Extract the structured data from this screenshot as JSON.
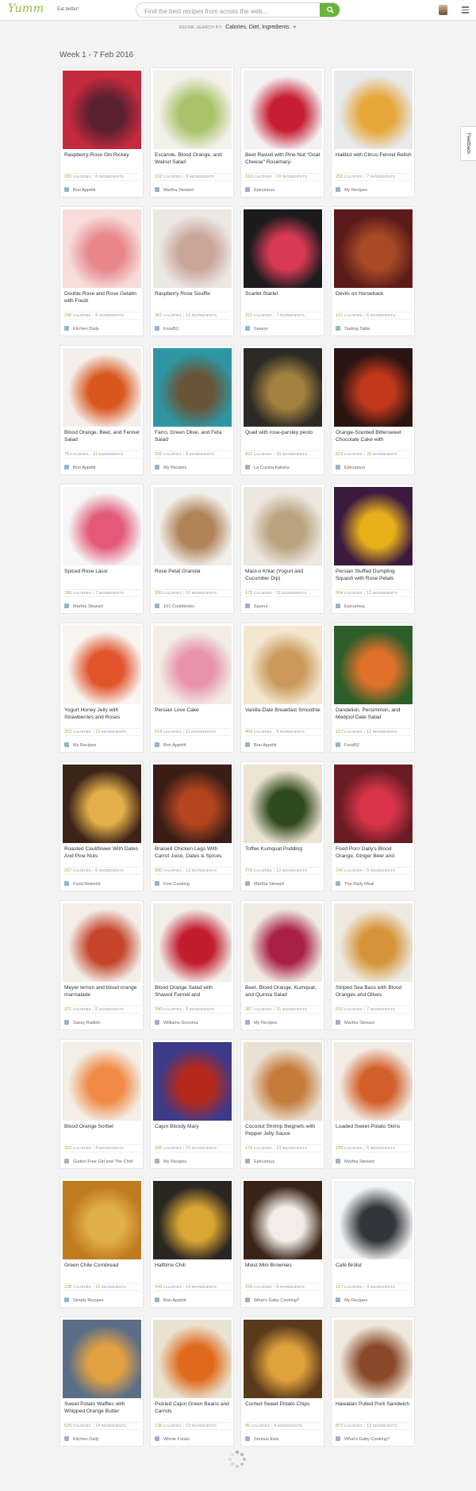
{
  "app": {
    "logo_text": "Yumm",
    "tagline": "Eat better!"
  },
  "search": {
    "placeholder": "Find the best recipes from across the web..."
  },
  "refine": {
    "label": "REFINE SEARCH BY:",
    "value": "Calories, Diet, Ingredients"
  },
  "feedback_label": "Feedback",
  "week_label": "Week 1 - 7 Feb 2016",
  "stat_labels": {
    "calories": "CALORIES",
    "ingredients": "INGREDIENTS"
  },
  "recipes": [
    {
      "title": "Raspberry-Rose Gin Rickey",
      "calories": "289",
      "ingredients": "6",
      "source": "Bon Appétit",
      "colors": [
        "#c62a3f",
        "#5b2030"
      ]
    },
    {
      "title": "Escarole, Blood Orange, and Walnut Salad",
      "calories": "152",
      "ingredients": "9",
      "source": "Martha Stewart",
      "colors": [
        "#f4f1ea",
        "#a9c36a"
      ]
    },
    {
      "title": "Beet Ravioli with Pine Nut \"Goat Cheese\" Rosemary-",
      "calories": "319",
      "ingredients": "19",
      "source": "Epicurious",
      "colors": [
        "#f3f1f1",
        "#c71e34"
      ]
    },
    {
      "title": "Halibut with Citrus-Fennel Relish",
      "calories": "253",
      "ingredients": "7",
      "source": "My Recipes",
      "colors": [
        "#e7e9ea",
        "#e7a63a"
      ]
    },
    {
      "title": "Double Rose and Rose Gelatin with Fresh",
      "calories": "246",
      "ingredients": "9",
      "source": "Kitchen Daily",
      "colors": [
        "#f7dcd9",
        "#e8868c"
      ]
    },
    {
      "title": "Raspberry Rose Souffle",
      "calories": "381",
      "ingredients": "12",
      "source": "Food52",
      "colors": [
        "#ebe7e3",
        "#c9a59a"
      ]
    },
    {
      "title": "Scarlet Starlet",
      "calories": "221",
      "ingredients": "7",
      "source": "Saveur",
      "colors": [
        "#1c1b1e",
        "#d83a55"
      ]
    },
    {
      "title": "Devils on Horseback",
      "calories": "101",
      "ingredients": "6",
      "source": "Tasting Table",
      "colors": [
        "#5b1b1a",
        "#a84a25"
      ]
    },
    {
      "title": "Blood Orange, Beet, and Fennel Salad",
      "calories": "75",
      "ingredients": "11",
      "source": "Bon Appétit",
      "colors": [
        "#f4efea",
        "#d9571f"
      ]
    },
    {
      "title": "Farro, Green Olive, and Feta Salad",
      "calories": "292",
      "ingredients": "8",
      "source": "My Recipes",
      "colors": [
        "#2e96a2",
        "#6a5438"
      ]
    },
    {
      "title": "Quail with rose-parsley pesto",
      "calories": "822",
      "ingredients": "15",
      "source": "La Cucina Italiana",
      "colors": [
        "#2d2a25",
        "#a2823e"
      ]
    },
    {
      "title": "Orange-Scented Bittersweet Chocolate Cake with",
      "calories": "823",
      "ingredients": "20",
      "source": "Epicurious",
      "colors": [
        "#2a1513",
        "#c1381b"
      ]
    },
    {
      "title": "Spiced Rose Lassi",
      "calories": "186",
      "ingredients": "7",
      "source": "Martha Stewart",
      "colors": [
        "#f6f6f6",
        "#e35a79"
      ]
    },
    {
      "title": "Rose Petal Granola",
      "calories": "300",
      "ingredients": "10",
      "source": "101 Cookbooks",
      "colors": [
        "#f2f0ec",
        "#b08358"
      ]
    },
    {
      "title": "Mast-o Khiar (Yogurt and Cucumber Dip)",
      "calories": "176",
      "ingredients": "11",
      "source": "Saveur",
      "colors": [
        "#ece7df",
        "#b9a37f"
      ]
    },
    {
      "title": "Persian Stuffed Dumpling Squash with Rose Petals",
      "calories": "504",
      "ingredients": "13",
      "source": "Epicurious",
      "colors": [
        "#3b1a40",
        "#e7b01b"
      ]
    },
    {
      "title": "Yogurt Honey Jelly with Strawberries and Roses",
      "calories": "203",
      "ingredients": "10",
      "source": "My Recipes",
      "colors": [
        "#f8f4f0",
        "#e2542c"
      ]
    },
    {
      "title": "Persian Love Cake",
      "calories": "619",
      "ingredients": "11",
      "source": "Bon Appétit",
      "colors": [
        "#f2eee6",
        "#e892ae"
      ]
    },
    {
      "title": "Vanilla-Date Breakfast Smoothie",
      "calories": "469",
      "ingredients": "5",
      "source": "Bon Appétit",
      "colors": [
        "#f4e7d2",
        "#c99a5a"
      ]
    },
    {
      "title": "Dandelion, Persimmon, and Medjool Date Salad",
      "calories": "157",
      "ingredients": "12",
      "source": "Food52",
      "colors": [
        "#2e5e2a",
        "#e1712a"
      ]
    },
    {
      "title": "Roasted Cauliflower With Dates And Pine Nuts",
      "calories": "207",
      "ingredients": "6",
      "source": "Food Network",
      "colors": [
        "#3d2418",
        "#e3b04a"
      ]
    },
    {
      "title": "Braised Chicken Legs With Carrot Juice, Dates & Spices",
      "calories": "990",
      "ingredients": "13",
      "source": "Fine Cooking",
      "colors": [
        "#3a1e15",
        "#b4451f"
      ]
    },
    {
      "title": "Toffee Kumquat Pudding",
      "calories": "279",
      "ingredients": "12",
      "source": "Martha Stewart",
      "colors": [
        "#ece3d3",
        "#2f4a1c"
      ]
    },
    {
      "title": "Food Porn Daily's Blood Orange, Ginger Beer and",
      "calories": "240",
      "ingredients": "5",
      "source": "The Daily Meal",
      "colors": [
        "#6a1c25",
        "#d9344a"
      ]
    },
    {
      "title": "Meyer lemon and blood orange marmalade",
      "calories": "371",
      "ingredients": "5",
      "source": "Sassy Radish",
      "colors": [
        "#f3eee8",
        "#c5442a"
      ]
    },
    {
      "title": "Blood Orange Salad with Shaved Fennel and",
      "calories": "340",
      "ingredients": "5",
      "source": "Williams-Sonoma",
      "colors": [
        "#f1ede8",
        "#c21d2e"
      ]
    },
    {
      "title": "Beet, Blood Orange, Kumquat, and Quinoa Salad",
      "calories": "367",
      "ingredients": "15",
      "source": "My Recipes",
      "colors": [
        "#efeae4",
        "#a82042"
      ]
    },
    {
      "title": "Striped Sea Bass with Blood Oranges and Olives",
      "calories": "510",
      "ingredients": "7",
      "source": "Martha Stewart",
      "colors": [
        "#eeeae2",
        "#d6943a"
      ]
    },
    {
      "title": "Blood Orange Sorbet",
      "calories": "322",
      "ingredients": "4",
      "source": "Gluten-Free Girl and The Chef",
      "colors": [
        "#f3eee6",
        "#f08a45"
      ]
    },
    {
      "title": "Cajun Bloody Mary",
      "calories": "286",
      "ingredients": "15",
      "source": "My Recipes",
      "colors": [
        "#3d3a8a",
        "#b5291c"
      ]
    },
    {
      "title": "Coconut Shrimp Beignets with Pepper Jelly Sauce",
      "calories": "174",
      "ingredients": "13",
      "source": "Epicurious",
      "colors": [
        "#e9e1d4",
        "#c57b3a"
      ]
    },
    {
      "title": "Loaded Sweet-Potato Skins",
      "calories": "195",
      "ingredients": "6",
      "source": "Martha Stewart",
      "colors": [
        "#f1ece6",
        "#d3602a"
      ]
    },
    {
      "title": "Green Chile Cornbread",
      "calories": "238",
      "ingredients": "13",
      "source": "Simply Recipes",
      "colors": [
        "#c07a1f",
        "#e1b04a"
      ]
    },
    {
      "title": "Halftime Chili",
      "calories": "543",
      "ingredients": "14",
      "source": "Bon Appétit",
      "colors": [
        "#2a2622",
        "#d9a533"
      ]
    },
    {
      "title": "Moist Mini Brownies",
      "calories": "256",
      "ingredients": "8",
      "source": "What's Gaby Cooking?",
      "colors": [
        "#3a2418",
        "#f2ede6"
      ]
    },
    {
      "title": "Café Brûlot",
      "calories": "127",
      "ingredients": "9",
      "source": "My Recipes",
      "colors": [
        "#f4f5f6",
        "#33353a"
      ]
    },
    {
      "title": "Sweet Potato Waffles with Whipped Orange Butter",
      "calories": "629",
      "ingredients": "14",
      "source": "Kitchen Daily",
      "colors": [
        "#5a6e87",
        "#e3a142"
      ]
    },
    {
      "title": "Pickled Cajun Green Beans and Carrots",
      "calories": "135",
      "ingredients": "13",
      "source": "Whole Foods",
      "colors": [
        "#e9e2cf",
        "#e06a1c"
      ]
    },
    {
      "title": "Curried Sweet Potato Chips",
      "calories": "95",
      "ingredients": "4",
      "source": "Serious Eats",
      "colors": [
        "#5b3a1c",
        "#e0a23d"
      ]
    },
    {
      "title": "Hawaiian Pulled Pork Sandwich",
      "calories": "873",
      "ingredients": "13",
      "source": "What's Gaby Cooking?",
      "colors": [
        "#efe8dc",
        "#8a4a2a"
      ]
    }
  ]
}
